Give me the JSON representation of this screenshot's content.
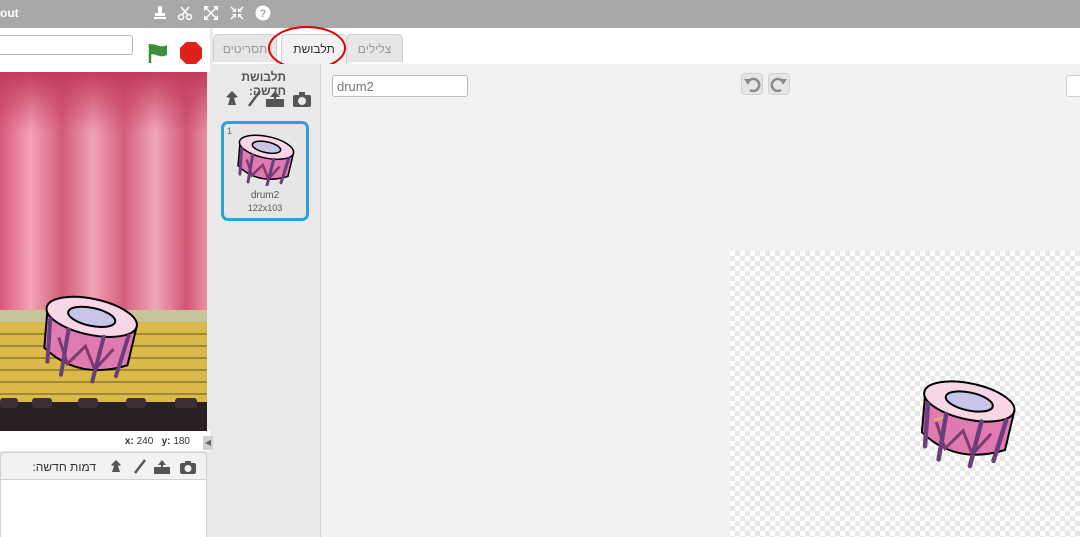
{
  "topbar": {
    "title_fragment": "out"
  },
  "tabs": [
    {
      "label": "תסריטים"
    },
    {
      "label": "תלבושת"
    },
    {
      "label": "צלילים"
    }
  ],
  "costumes_panel": {
    "new_costume_label": "תלבושת חדשה:"
  },
  "costume": {
    "index": "1",
    "name": "drum2",
    "size": "122x103"
  },
  "editor": {
    "name_field": "drum2"
  },
  "stage_info": {
    "x_label": "x:",
    "x_value": "240",
    "y_label": "y:",
    "y_value": "180"
  },
  "sprites": {
    "new_sprite_label": "דמות חדשה:"
  },
  "colors": {
    "selected_tile": "#2fa0d7",
    "highlight_circle": "#e00000",
    "flag": "#3b8e3a",
    "stop": "#e0201b"
  }
}
